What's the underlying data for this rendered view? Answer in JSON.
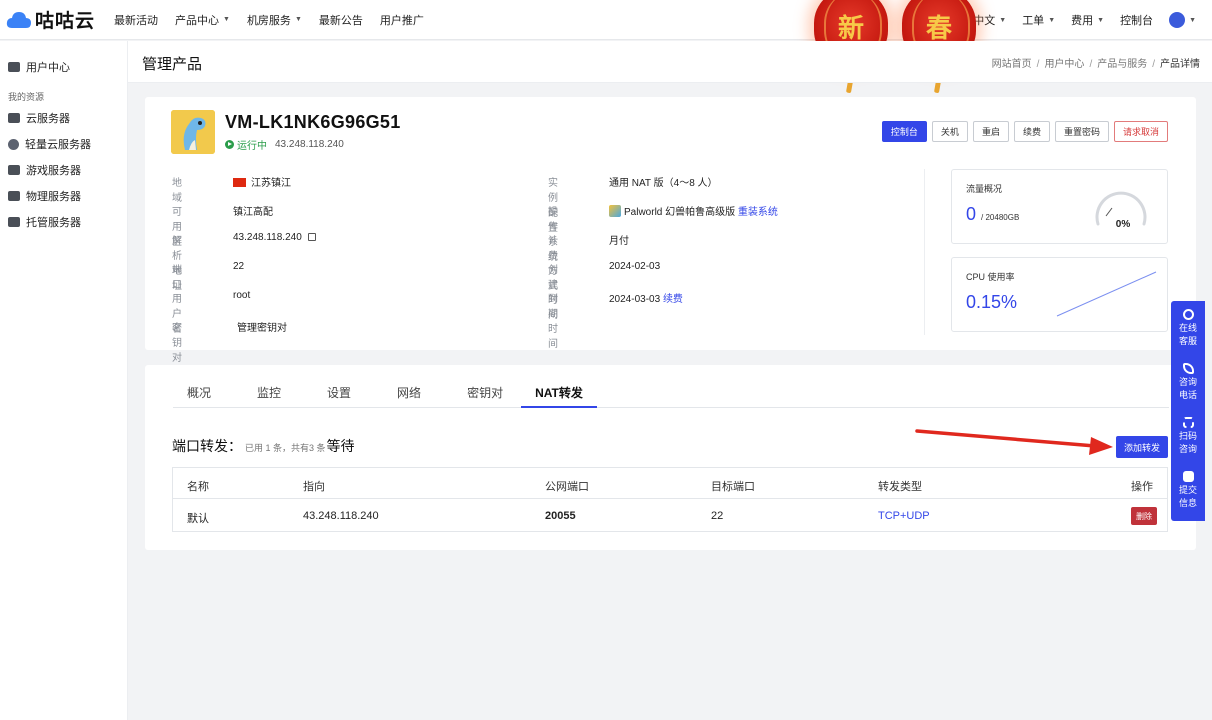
{
  "brand": {
    "name": "咕咕云"
  },
  "nav": {
    "items": [
      {
        "label": "最新活动",
        "dropdown": false
      },
      {
        "label": "产品中心",
        "dropdown": true
      },
      {
        "label": "机房服务",
        "dropdown": true
      },
      {
        "label": "最新公告",
        "dropdown": false
      },
      {
        "label": "用户推广",
        "dropdown": false
      }
    ],
    "right": [
      {
        "label": "中文",
        "dropdown": true
      },
      {
        "label": "工单",
        "dropdown": true
      },
      {
        "label": "费用",
        "dropdown": true
      },
      {
        "label": "控制台",
        "dropdown": false
      }
    ]
  },
  "lanterns": [
    "新",
    "春"
  ],
  "sidebar": {
    "user_center": "用户中心",
    "group_label": "我的资源",
    "items": [
      "云服务器",
      "轻量云服务器",
      "游戏服务器",
      "物理服务器",
      "托管服务器"
    ]
  },
  "header": {
    "title": "管理产品",
    "breadcrumb": [
      "网站首页",
      "用户中心",
      "产品与服务",
      "产品详情"
    ]
  },
  "instance": {
    "name": "VM-LK1NK6G96G51",
    "status": "运行中",
    "ip": "43.248.118.240",
    "actions": [
      "控制台",
      "关机",
      "重启",
      "续费",
      "重置密码",
      "请求取消"
    ],
    "left_info": [
      {
        "label": "地域",
        "value": "江苏镇江"
      },
      {
        "label": "可用区",
        "value": "镇江高配"
      },
      {
        "label": "解析地址",
        "value": "43.248.118.240"
      },
      {
        "label": "端口",
        "value": "22"
      },
      {
        "label": "用户名",
        "value": "root"
      },
      {
        "label": "密钥对",
        "value": "管理密钥对"
      }
    ],
    "right_info": [
      {
        "label": "实例配置",
        "value": "通用 NAT 版（4～8 人）"
      },
      {
        "label": "操作系统",
        "value": "Palworld 幻兽帕鲁高级版",
        "link": "重装系统"
      },
      {
        "label": "计费方式",
        "value": "月付"
      },
      {
        "label": "创建时间",
        "value": "2024-02-03"
      },
      {
        "label": "到期时间",
        "value": "2024-03-03",
        "link": "续费"
      }
    ]
  },
  "stats": {
    "traffic": {
      "title": "流量概况",
      "value": "0",
      "total": "/ 20480GB",
      "percent_label": "0%",
      "percent": 0
    },
    "cpu": {
      "title": "CPU 使用率",
      "value": "0.15%"
    }
  },
  "tabs": [
    "概况",
    "监控",
    "设置",
    "网络",
    "密钥对",
    "NAT转发"
  ],
  "active_tab": "NAT转发",
  "port_forward": {
    "title": "端口转发：",
    "note": "已用 1 条，共有3 条",
    "suffix": "等待",
    "add_button": "添加转发",
    "columns": [
      "名称",
      "指向",
      "公网端口",
      "目标端口",
      "转发类型",
      "操作"
    ],
    "rows": [
      {
        "name": "默认",
        "target": "43.248.118.240",
        "public_port": "20055",
        "target_port": "22",
        "type": "TCP+UDP",
        "action": "删除"
      }
    ]
  },
  "float_panel": [
    {
      "line1": "在线",
      "line2": "客服"
    },
    {
      "line1": "咨询",
      "line2": "电话"
    },
    {
      "line1": "扫码",
      "line2": "咨询"
    },
    {
      "line1": "提交",
      "line2": "信息"
    }
  ],
  "colors": {
    "primary": "#3346e8",
    "success": "#2a9d4a",
    "danger": "#c0323a",
    "lantern": "#c4180f"
  }
}
